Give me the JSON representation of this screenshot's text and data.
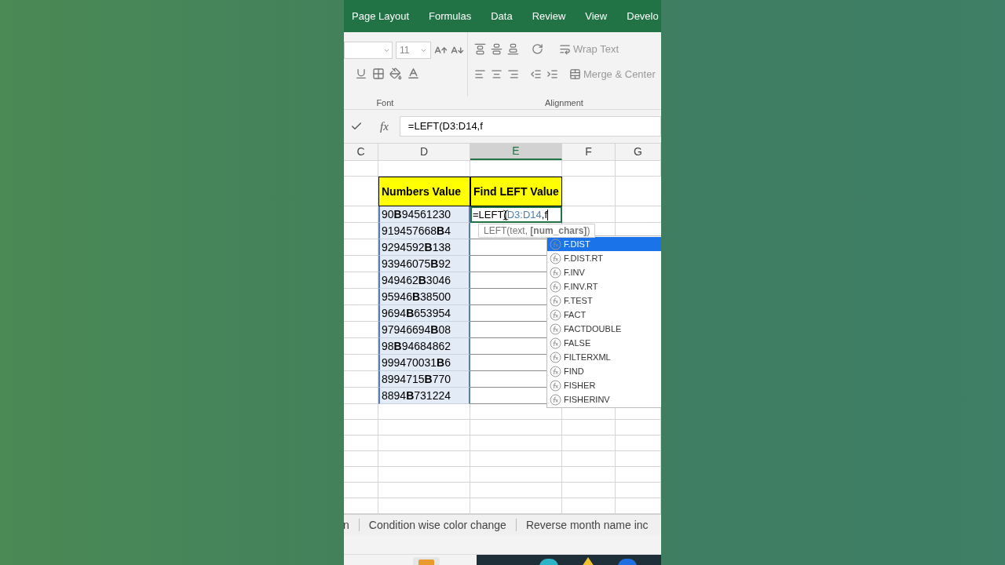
{
  "ribbon_tabs": [
    "Page Layout",
    "Formulas",
    "Data",
    "Review",
    "View",
    "Develo"
  ],
  "ribbon": {
    "font_size": "11",
    "wrap_text": "Wrap Text",
    "merge_center": "Merge & Center",
    "groups": [
      "Font",
      "Alignment"
    ]
  },
  "formula_bar": {
    "fx": "fx",
    "value": "=LEFT(D3:D14,f"
  },
  "columns": [
    {
      "label": "C",
      "selected": false
    },
    {
      "label": "D",
      "selected": false
    },
    {
      "label": "E",
      "selected": true
    },
    {
      "label": "F",
      "selected": false
    },
    {
      "label": "G",
      "selected": false
    }
  ],
  "headers": [
    "Numbers Value",
    "Find LEFT Value"
  ],
  "active_cell": {
    "prefix": "=LEFT(",
    "reference": "D3:D14",
    "suffix": ",f"
  },
  "rows": [
    "90**B**94561230",
    "919457668**B**4",
    "9294592**B**138",
    "93946075**B**92",
    "949462**B**3046",
    "95946**B**38500",
    "9694**B**653954",
    "97946694**B**08",
    "98**B**94684862",
    "999470031**B**6",
    "8994715**B**770",
    "8894**B**731224"
  ],
  "tooltip": "LEFT(text, **[num_chars]**)",
  "autocomplete": [
    {
      "label": "F.DIST",
      "selected": true
    },
    {
      "label": "F.DIST.RT",
      "selected": false
    },
    {
      "label": "F.INV",
      "selected": false
    },
    {
      "label": "F.INV.RT",
      "selected": false
    },
    {
      "label": "F.TEST",
      "selected": false
    },
    {
      "label": "FACT",
      "selected": false
    },
    {
      "label": "FACTDOUBLE",
      "selected": false
    },
    {
      "label": "FALSE",
      "selected": false
    },
    {
      "label": "FILTERXML",
      "selected": false
    },
    {
      "label": "FIND",
      "selected": false
    },
    {
      "label": "FISHER",
      "selected": false
    },
    {
      "label": "FISHERINV",
      "selected": false
    }
  ],
  "sheet_tabs": [
    "n",
    "Condition wise color change",
    "Reverse month name inc"
  ]
}
